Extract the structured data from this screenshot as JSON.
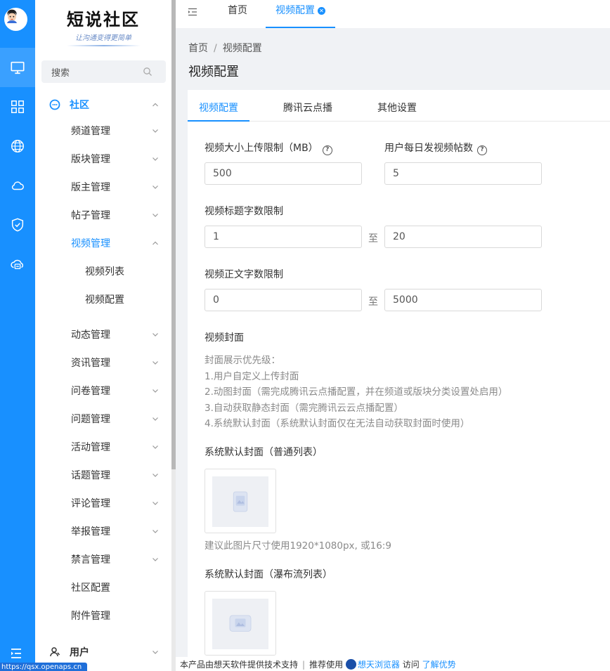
{
  "brand": {
    "title": "短说社区",
    "subtitle": "让沟通变得更简单"
  },
  "search": {
    "placeholder": "搜索"
  },
  "menu": {
    "group_label": "社区",
    "items": [
      {
        "label": "频道管理"
      },
      {
        "label": "版块管理"
      },
      {
        "label": "版主管理"
      },
      {
        "label": "帖子管理"
      },
      {
        "label": "视频管理"
      },
      {
        "label": "视频列表"
      },
      {
        "label": "视频配置"
      },
      {
        "label": "动态管理"
      },
      {
        "label": "资讯管理"
      },
      {
        "label": "问卷管理"
      },
      {
        "label": "问题管理"
      },
      {
        "label": "活动管理"
      },
      {
        "label": "话题管理"
      },
      {
        "label": "评论管理"
      },
      {
        "label": "举报管理"
      },
      {
        "label": "禁言管理"
      },
      {
        "label": "社区配置"
      },
      {
        "label": "附件管理"
      }
    ],
    "user_group_label": "用户"
  },
  "topbar": {
    "tabs": [
      {
        "label": "首页"
      },
      {
        "label": "视频配置"
      }
    ]
  },
  "breadcrumb": {
    "home": "首页",
    "sep": "/",
    "current": "视频配置"
  },
  "page_title": "视频配置",
  "card_tabs": [
    {
      "label": "视频配置"
    },
    {
      "label": "腾讯云点播"
    },
    {
      "label": "其他设置"
    }
  ],
  "form": {
    "size_limit_label": "视频大小上传限制（MB）",
    "size_limit_value": "500",
    "daily_posts_label": "用户每日发视频帖数",
    "daily_posts_value": "5",
    "title_len_label": "视频标题字数限制",
    "title_min": "1",
    "title_max": "20",
    "body_len_label": "视频正文字数限制",
    "body_min": "0",
    "body_max": "5000",
    "range_to": "至",
    "cover_label": "视频封面",
    "cover_notes": [
      "封面展示优先级：",
      "1.用户自定义上传封面",
      "2.动图封面（需完成腾讯云点播配置，并在频道或版块分类设置处启用）",
      "3.自动获取静态封面（需完腾讯云云点播配置）",
      "4.系统默认封面（系统默认封面仅在无法自动获取封面时使用）"
    ],
    "default_cover_normal_label": "系统默认封面（普通列表）",
    "default_cover_hint": "建议此图片尺寸使用1920*1080px, 或16:9",
    "default_cover_waterfall_label": "系统默认封面（瀑布流列表）"
  },
  "footer": {
    "support": "本产品由想天软件提供技术支持",
    "sep": "|",
    "recommend": "推荐使用",
    "browser": "想天浏览器",
    "visit": "访问",
    "learn": "了解优势"
  },
  "status_url": "https://qsx.openaps.cn",
  "colors": {
    "accent": "#1890ff",
    "rail": "#1890ff"
  },
  "icons": [
    "monitor-icon",
    "grid-icon",
    "globe-icon",
    "cloud-icon",
    "shield-icon",
    "cloud-sync-icon",
    "menu-fold-icon",
    "search-icon",
    "chevron-down-icon",
    "chevron-up-icon",
    "chat-icon",
    "user-icon",
    "close-icon",
    "help-icon",
    "image-icon"
  ]
}
